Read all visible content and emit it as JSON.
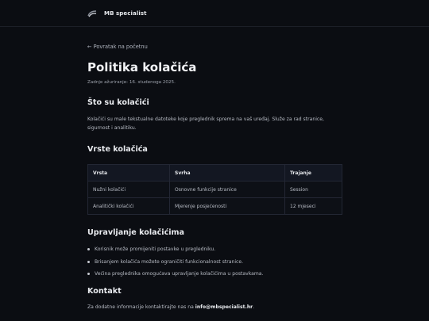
{
  "header": {
    "logo_icon": "mb-logo-icon",
    "brand": "MB specialist"
  },
  "page": {
    "back_link": "← Povratak na početnu",
    "title": "Politika kolačića",
    "updated": "Zadnje ažuriranje: 16. studenoga 2025."
  },
  "section_what": {
    "heading": "Što su kolačići",
    "text": "Kolačići su male tekstualne datoteke koje preglednik sprema na vaš uređaj. Služe za rad stranice, sigurnost i analitiku."
  },
  "section_types": {
    "heading": "Vrste kolačića",
    "columns": [
      "Vrsta",
      "Svrha",
      "Trajanje"
    ],
    "rows": [
      [
        "Nužni kolačići",
        "Osnovne funkcije stranice",
        "Session"
      ],
      [
        "Analitički kolačići",
        "Mjerenje posjećenosti",
        "12 mjeseci"
      ]
    ]
  },
  "section_manage": {
    "heading": "Upravljanje kolačićima",
    "items": [
      "Korisnik može promijeniti postavke u pregledniku.",
      "Brisanjem kolačića možete ograničiti funkcionalnost stranice.",
      "Većina preglednika omogućava upravljanje kolačićima u postavkama."
    ]
  },
  "section_contact": {
    "heading": "Kontakt",
    "text": "Za dodatne informacije kontaktirajte nas na ",
    "email": "info@mbspecialist.hr",
    "suffix": "."
  },
  "colors": {
    "background": "#0b0d12",
    "table_header": "#131722",
    "border": "#232734"
  }
}
